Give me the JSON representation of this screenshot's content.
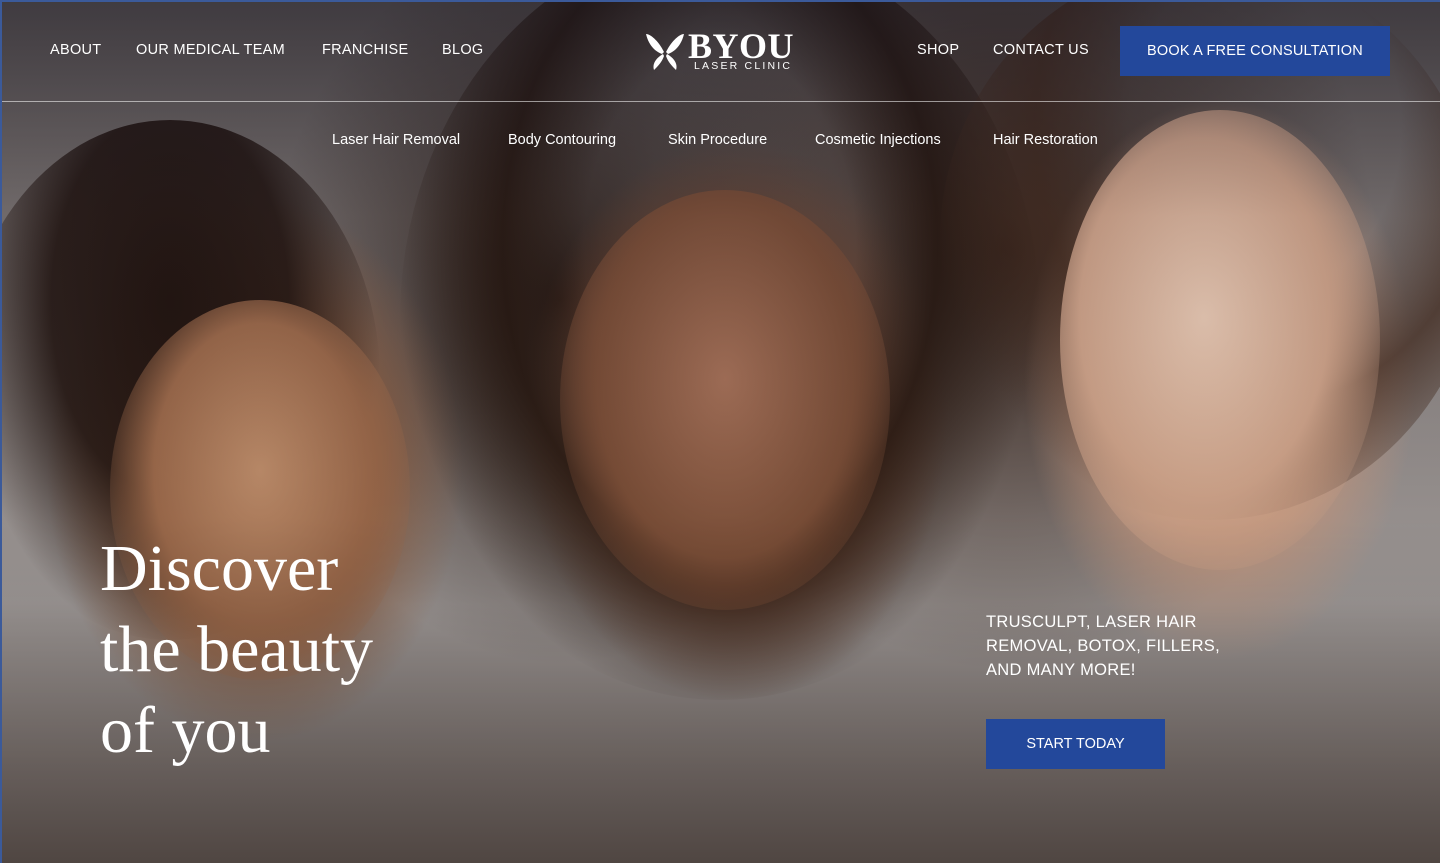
{
  "header": {
    "left_nav": [
      "ABOUT",
      "OUR MEDICAL TEAM",
      "FRANCHISE",
      "BLOG"
    ],
    "right_nav": [
      "SHOP",
      "CONTACT US"
    ],
    "cta": "BOOK A FREE CONSULTATION",
    "logo": {
      "word": "BYOU",
      "sub": "LASER CLINIC"
    }
  },
  "subnav": [
    "Laser Hair Removal",
    "Body Contouring",
    "Skin Procedure",
    "Cosmetic Injections",
    "Hair Restoration"
  ],
  "hero": {
    "headline": [
      "Discover",
      "the beauty",
      "of you"
    ],
    "services_text": "TRUSCULPT, LASER HAIR REMOVAL, BOTOX, FILLERS, AND MANY MORE!",
    "cta": "START TODAY"
  },
  "colors": {
    "accent": "#23489b",
    "text": "#ffffff"
  }
}
